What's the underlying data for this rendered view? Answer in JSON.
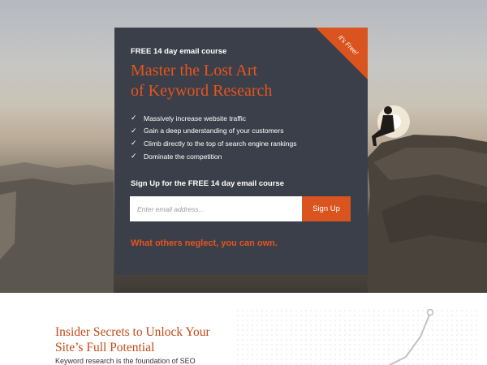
{
  "hero": {
    "ribbon": "It's Free!",
    "eyebrow": "FREE 14 day email course",
    "headline_line1": "Master the Lost Art",
    "headline_line2": "of Keyword Research",
    "benefits": [
      "Massively increase website traffic",
      "Gain a deep understanding of your customers",
      "Climb directly to the top of search engine rankings",
      "Dominate the competition"
    ],
    "signup_label": "Sign Up for the FREE 14 day email course",
    "email_placeholder": "Enter email address...",
    "signup_button": "Sign Up",
    "tagline": "What others neglect, you can own."
  },
  "section": {
    "title_line1": "Insider Secrets to Unlock Your",
    "title_line2": "Site’s Full Potential",
    "text": "Keyword research is the foundation of SEO"
  },
  "colors": {
    "accent": "#e6551f",
    "card": "#3b3f49",
    "button": "#d9541e"
  }
}
